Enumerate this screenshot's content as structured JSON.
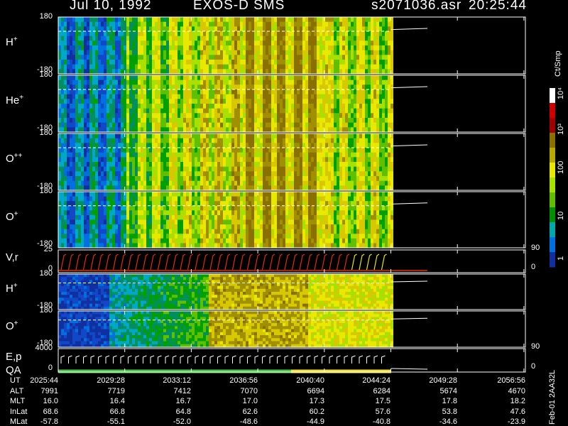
{
  "header": {
    "date": "Jul 10, 1992",
    "mission": "EXOS-D SMS",
    "file": "s2071036.asr",
    "time": "20:25:44"
  },
  "panels": [
    {
      "label": "H",
      "sup": "+",
      "top": "180",
      "bottom": "-180"
    },
    {
      "label": "He",
      "sup": "+",
      "top": "180",
      "bottom": "-180"
    },
    {
      "label": "O",
      "sup": "++",
      "top": "180",
      "bottom": "-180"
    },
    {
      "label": "O",
      "sup": "+",
      "top": "180",
      "bottom": "-180"
    },
    {
      "label": "V,r",
      "sup": "",
      "top": "25",
      "bottom": "0",
      "right_top": "90",
      "right_bottom": "0"
    },
    {
      "label": "H",
      "sup": "+",
      "top": "180",
      "bottom": "-180"
    },
    {
      "label": "O",
      "sup": "+",
      "top": "180",
      "bottom": "-180"
    },
    {
      "label": "E,p",
      "sup": "",
      "label2": "QA",
      "top": "4000",
      "bottom": "0",
      "right_top": "90",
      "right_bottom": "0"
    }
  ],
  "colorbar": {
    "unit": "Ct/Smp",
    "ticks": [
      "10⁴",
      "10³",
      "100",
      "10",
      "1"
    ],
    "colors": [
      "#ffffff",
      "#d00000",
      "#a00000",
      "#8a7000",
      "#b8a800",
      "#e8e800",
      "#a8e000",
      "#60c000",
      "#009000",
      "#00a8a8",
      "#0070e0",
      "#1030a0"
    ]
  },
  "footer": {
    "rows": [
      {
        "name": "UT",
        "values": [
          "2025:44",
          "2029:28",
          "2033:12",
          "2036:56",
          "2040:40",
          "2044:24",
          "2049:28",
          "2056:56"
        ]
      },
      {
        "name": "ALT",
        "values": [
          "7991",
          "7719",
          "7412",
          "7070",
          "6694",
          "6284",
          "5674",
          "4670"
        ]
      },
      {
        "name": "MLT",
        "values": [
          "16.0",
          "16.4",
          "16.7",
          "17.0",
          "17.3",
          "17.5",
          "17.8",
          "18.2"
        ]
      },
      {
        "name": "InLat",
        "values": [
          "68.6",
          "66.8",
          "64.8",
          "62.6",
          "60.2",
          "57.6",
          "53.8",
          "47.6"
        ]
      },
      {
        "name": "MLat",
        "values": [
          "-57.8",
          "-55.1",
          "-52.0",
          "-48.6",
          "-44.9",
          "-40.8",
          "-34.6",
          "-23.9"
        ]
      }
    ],
    "side_text": "Feb-01 2AA32L"
  },
  "chart_data": {
    "type": "heatmap",
    "title": "Jul 10, 1992   EXOS-D SMS",
    "x_ticks": [
      "2025:44",
      "2029:28",
      "2033:12",
      "2036:56",
      "2040:40",
      "2044:24",
      "2049:28",
      "2056:56"
    ],
    "panels": [
      "H+",
      "He+",
      "O++",
      "O+",
      "V,r",
      "H+",
      "O+",
      "E,p QA"
    ],
    "y_range_pitch": [
      -180,
      180
    ],
    "colorbar_range": [
      1,
      10000
    ],
    "colorbar_scale": "log"
  }
}
